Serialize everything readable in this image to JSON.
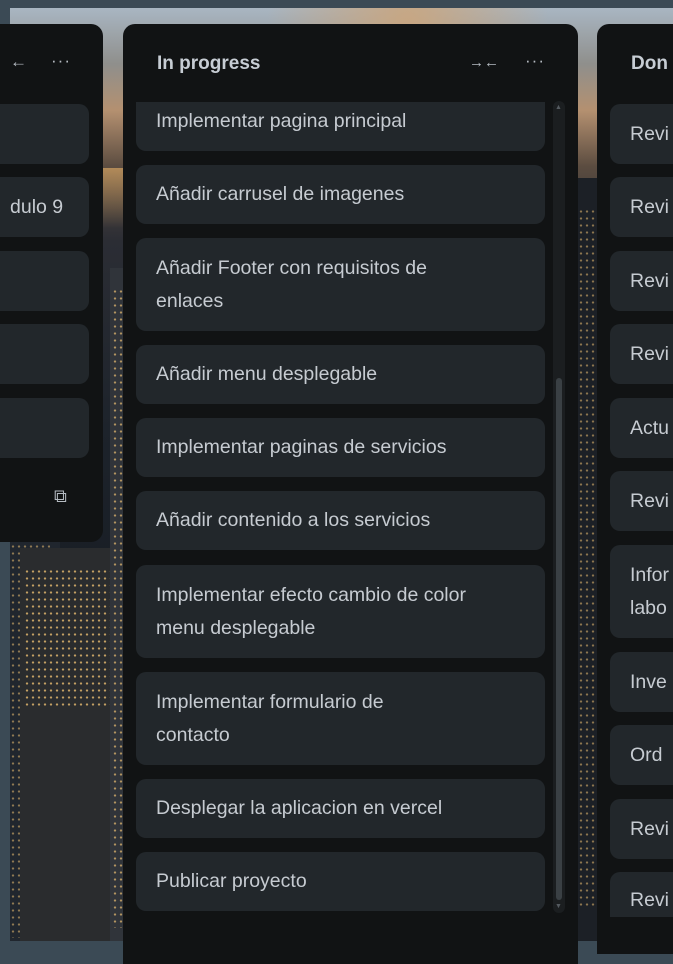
{
  "left_list": {
    "collapse_icon": "collapse-arrow-icon",
    "collapse_glyph": "←",
    "more_glyph": "···",
    "cards": [
      "",
      "dulo 9",
      "",
      "",
      ""
    ],
    "footer_icon": "template-icon",
    "footer_glyph": "⧉"
  },
  "middle_list": {
    "title": "In progress",
    "collapse_glyph": "→←",
    "more_glyph": "···",
    "cards": [
      "Implementar pagina principal",
      "Añadir carrusel de imagenes",
      "Añadir Footer con requisitos de enlaces",
      "Añadir menu desplegable",
      "Implementar paginas de servicios",
      "Añadir contenido a los servicios",
      "Implementar efecto cambio de color menu desplegable",
      "Implementar formulario de contacto",
      "Desplegar la aplicacion en vercel",
      "Publicar proyecto"
    ]
  },
  "right_list": {
    "title": "Don",
    "cards": [
      "Revi",
      "Revi",
      "Revi",
      "Revi",
      "Actu",
      "Revi",
      "Infor labo",
      "Inve",
      "Ord",
      "Revi",
      "Revi"
    ]
  },
  "colors": {
    "list_bg": "#111314",
    "card_bg": "#22272b",
    "text": "#c6cbd1",
    "page_frame": "#3b4a55"
  }
}
